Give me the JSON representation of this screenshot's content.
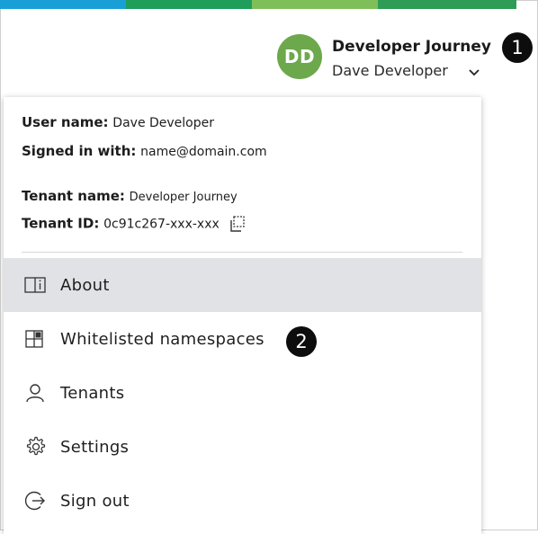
{
  "header": {
    "avatar_initials": "DD",
    "tenant_title": "Developer Journey",
    "user_display": "Dave Developer",
    "colors": {
      "avatar": "#6ea84c",
      "stripe": [
        "#18a0d6",
        "#1f9e5a",
        "#7fbf5a",
        "#2e9c55"
      ]
    }
  },
  "callouts": {
    "one": "1",
    "two": "2"
  },
  "account": {
    "user_name_label": "User name:",
    "user_name_value": "Dave Developer",
    "signed_in_label": "Signed in with:",
    "signed_in_value": "name@domain.com",
    "tenant_name_label": "Tenant name:",
    "tenant_name_value": "Developer Journey",
    "tenant_id_label": "Tenant ID:",
    "tenant_id_value": "0c91c267-xxx-xxx"
  },
  "menu": {
    "items": [
      {
        "label": "About",
        "icon": "book-info-icon",
        "active": true
      },
      {
        "label": "Whitelisted namespaces",
        "icon": "grid-namespaces-icon",
        "active": false
      },
      {
        "label": "Tenants",
        "icon": "person-icon",
        "active": false
      },
      {
        "label": "Settings",
        "icon": "gear-icon",
        "active": false
      },
      {
        "label": "Sign out",
        "icon": "sign-out-icon",
        "active": false
      }
    ]
  }
}
